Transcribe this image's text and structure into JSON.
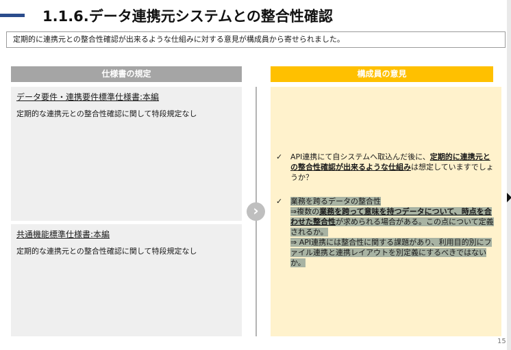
{
  "slide": {
    "title": "1.1.6.データ連携元システムとの整合性確認",
    "summary": "定期的に連携元との整合性確認が出来るような仕組みに対する意見が構成員から寄せられました。",
    "page_number": "15"
  },
  "left_column": {
    "header": "仕様書の規定",
    "sections": [
      {
        "title": "データ要件・連携要件標準仕様書:本編",
        "body": "定期的な連携元との整合性確認に関して特段規定なし"
      },
      {
        "title": "共通機能標準仕様書:本編",
        "body": "定期的な連携元との整合性確認に関して特段規定なし"
      }
    ]
  },
  "right_column": {
    "header": "構成員の意見",
    "check_mark": "✓",
    "item1": {
      "part1": "API連携にて自システムへ取込んだ後に、",
      "part2": "定期的に連携元との整合性確認が出来るような仕組み",
      "part3": "は想定していますでしょうか？"
    },
    "item2": {
      "line1": "業務を跨るデータの整合性",
      "p1": "⇒複数の",
      "p2": "業務を跨って意味を持つデータについて、時点を合わせた整合性",
      "p3": "が求められる場合がある。この点について定義されるか。",
      "p4": "⇒ API連携には整合性に関する課題があり、利用目的別にファイル連携と連携レイアウトを別定義にするべきではないか。"
    }
  },
  "icons": {
    "arrow": "chevron-right-circle-icon"
  }
}
